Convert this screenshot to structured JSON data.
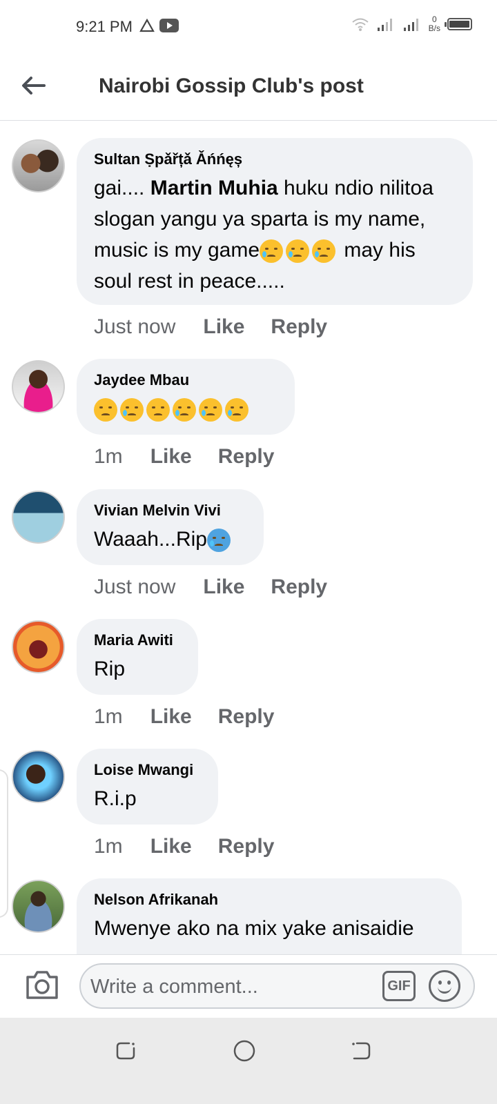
{
  "status_bar": {
    "time": "9:21 PM",
    "net_speed_value": "0",
    "net_speed_unit": "B/s",
    "battery_level": 0.9
  },
  "header": {
    "title": "Nairobi Gossip Club's post"
  },
  "comments": [
    {
      "author": "Sultan Ṣpǎřțǎ Ǎńńęș",
      "text_before": "gai.... ",
      "mention": "Martin Muhia",
      "text_after": " huku ndio nilitoa slogan yangu ya sparta is my name, music is my game",
      "text_end": " may his soul rest in peace.....",
      "time": "Just now",
      "like": "Like",
      "reply": "Reply"
    },
    {
      "author": "Jaydee Mbau",
      "time": "1m",
      "like": "Like",
      "reply": "Reply"
    },
    {
      "author": "Vivian Melvin Vivi",
      "text": "Waaah...Rip",
      "time": "Just now",
      "like": "Like",
      "reply": "Reply"
    },
    {
      "author": "Maria Awiti",
      "text": "Rip",
      "time": "1m",
      "like": "Like",
      "reply": "Reply"
    },
    {
      "author": "Loise Mwangi",
      "text": "R.i.p",
      "time": "1m",
      "like": "Like",
      "reply": "Reply"
    },
    {
      "author": "Nelson Afrikanah",
      "text": "Mwenye ako na mix yake anisaidie"
    }
  ],
  "composer": {
    "placeholder": "Write a comment...",
    "gif_label": "GIF"
  },
  "icons": {
    "back": "arrow-left-icon",
    "camera": "camera-icon",
    "emoji": "smiley-icon"
  }
}
